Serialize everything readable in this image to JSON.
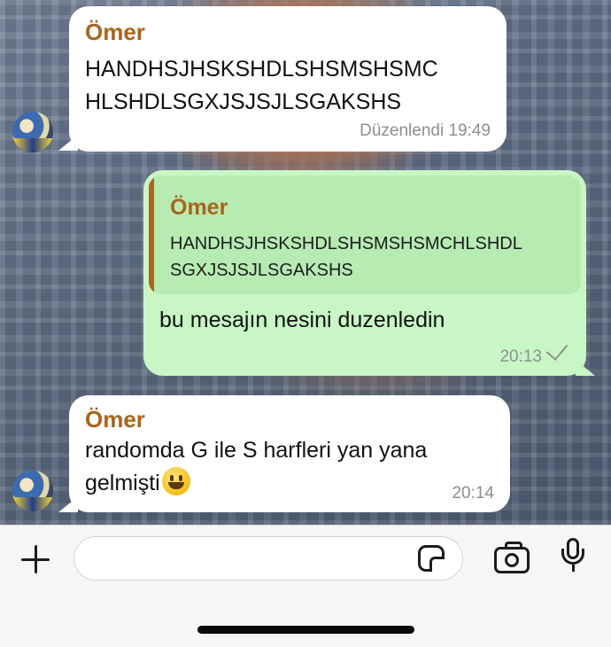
{
  "messages": [
    {
      "sender": "Ömer",
      "line1": "HANDHSJHSKSHDLSHSMSHSMC",
      "line2": "HLSHDLSGXJSJSJLSGAKSHS",
      "meta": "Düzenlendi 19:49"
    },
    {
      "quote_sender": "Ömer",
      "quote_line1": "HANDHSJHSKSHDLSHSMSHSMCHLSHDL",
      "quote_line2": "SGXJSJSJLSGAKSHS",
      "text": "bu mesajın nesini duzenledin",
      "time": "20:13"
    },
    {
      "sender": "Ömer",
      "line1": "randomda G ile S harfleri yan yana",
      "line2": "gelmişti",
      "emoji": "grinning-face-emoji",
      "time": "20:14"
    }
  ],
  "composer": {
    "placeholder": "",
    "icons": [
      "plus-icon",
      "sticker-icon",
      "camera-icon",
      "microphone-icon"
    ]
  },
  "colors": {
    "incoming_bubble": "#ffffff",
    "outgoing_bubble": "#c8f7c5",
    "sender_name": "#a9651b",
    "meta_text": "#8e8e93"
  }
}
